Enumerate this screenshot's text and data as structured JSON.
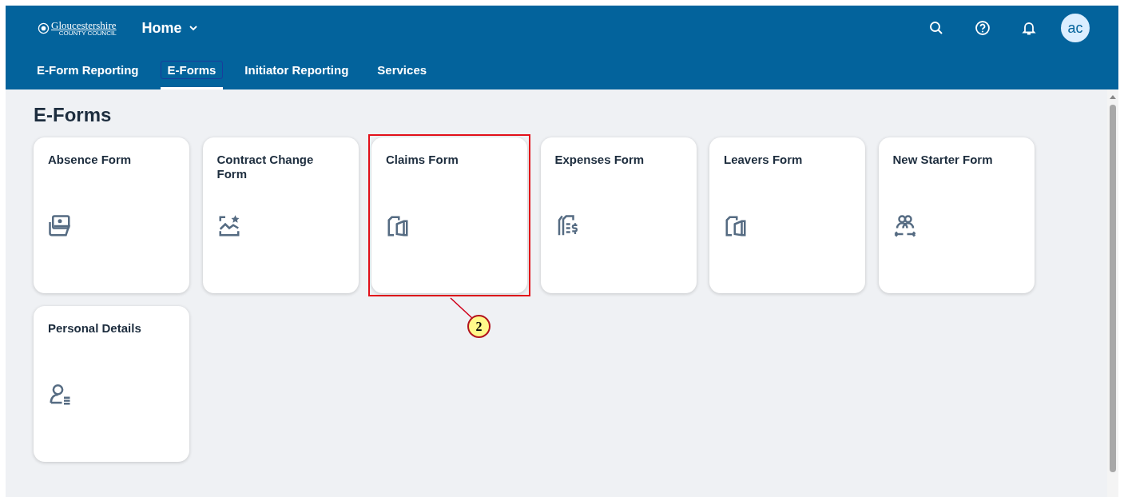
{
  "header": {
    "logo": {
      "name": "Gloucestershire",
      "subtitle": "COUNTY COUNCIL"
    },
    "menu": {
      "label": "Home"
    },
    "avatar": "ac"
  },
  "tabs": [
    {
      "label": "E-Form Reporting",
      "selected": false
    },
    {
      "label": "E-Forms",
      "selected": true
    },
    {
      "label": "Initiator Reporting",
      "selected": false
    },
    {
      "label": "Services",
      "selected": false
    }
  ],
  "page_title": "E-Forms",
  "tiles": [
    {
      "title": "Absence Form",
      "highlighted": false
    },
    {
      "title": "Contract Change Form",
      "highlighted": false
    },
    {
      "title": "Claims Form",
      "highlighted": true
    },
    {
      "title": "Expenses Form",
      "highlighted": false
    },
    {
      "title": "Leavers Form",
      "highlighted": false
    },
    {
      "title": "New Starter Form",
      "highlighted": false
    },
    {
      "title": "Personal Details",
      "highlighted": false
    }
  ],
  "annotation": {
    "label": "2"
  }
}
